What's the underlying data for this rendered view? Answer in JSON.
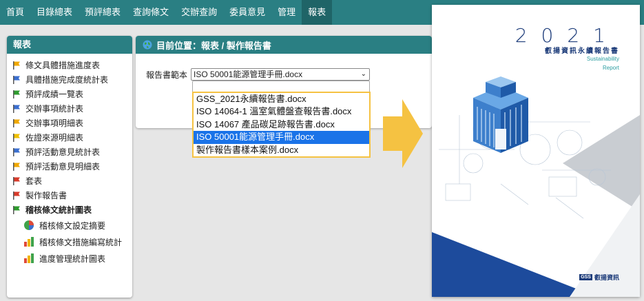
{
  "nav": {
    "items": [
      "首頁",
      "目錄總表",
      "預評總表",
      "查詢條文",
      "交辦查詢",
      "委員意見",
      "管理",
      "報表"
    ],
    "active_index": 7
  },
  "sidebar": {
    "title": "報表",
    "items": [
      {
        "label": "條文具體措施進度表",
        "flag_color": "#f0a800"
      },
      {
        "label": "具體措施完成度統計表",
        "flag_color": "#3b6fd0"
      },
      {
        "label": "預評成績一覽表",
        "flag_color": "#2e9b2e"
      },
      {
        "label": "交辦事項統計表",
        "flag_color": "#3b6fd0"
      },
      {
        "label": "交辦事項明細表",
        "flag_color": "#f0a800"
      },
      {
        "label": "佐證來源明細表",
        "flag_color": "#f0c000"
      },
      {
        "label": "預評活動意見統計表",
        "flag_color": "#3b6fd0"
      },
      {
        "label": "預評活動意見明細表",
        "flag_color": "#f0a800"
      },
      {
        "label": "套表",
        "flag_color": "#d83a2a"
      },
      {
        "label": "製作報告書",
        "flag_color": "#d83a2a"
      },
      {
        "label": "稽核條文統計圖表",
        "flag_color": "#2e9b2e",
        "bold": true
      }
    ],
    "subitems": [
      {
        "label": "稽核條文設定摘要",
        "icon": "pie-chart-icon"
      },
      {
        "label": "稽核條文措施編寫統計",
        "icon": "bar-chart-icon"
      },
      {
        "label": "進度管理統計圖表",
        "icon": "bar-chart-icon"
      }
    ]
  },
  "main": {
    "breadcrumb": "目前位置：報表 / 製作報告書",
    "template_label": "報告書範本",
    "template_value": "ISO 50001能源管理手冊.docx",
    "options": [
      "GSS_2021永續報告書.docx",
      "ISO 14064-1 溫室氣體盤查報告書.docx",
      "ISO 14067 產品碳足跡報告書.docx",
      "ISO 50001能源管理手冊.docx",
      "製作報告書樣本案例.docx"
    ],
    "selected_option_index": 3
  },
  "cover": {
    "year": "2021",
    "title": "叡揚資訊永續報告書",
    "subtitle1": "Sustainability",
    "subtitle2": "Report",
    "logo_mark": "GSS",
    "logo_text": "叡揚資訊"
  },
  "colors": {
    "teal": "#2a7f83",
    "highlight": "#f5c242",
    "selection": "#1a73e8",
    "navy": "#1d3c7a"
  }
}
